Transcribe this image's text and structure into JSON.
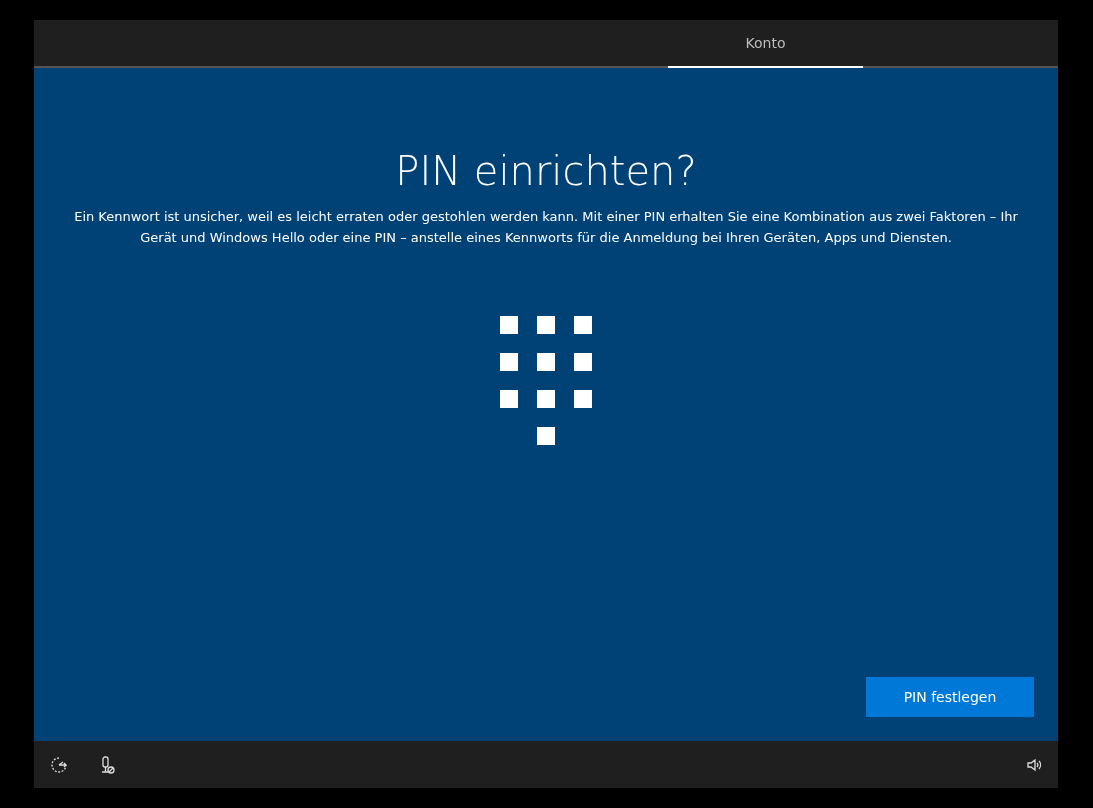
{
  "tabs": [
    {
      "label": "Konto",
      "selected": true
    }
  ],
  "title": "PIN einrichten?",
  "description": "Ein Kennwort ist unsicher, weil es leicht erraten oder gestohlen werden kann. Mit einer PIN erhalten Sie eine Kombination aus zwei Faktoren – Ihr Gerät und Windows Hello oder eine PIN – anstelle eines Kennworts für die Anmeldung bei Ihren Geräten, Apps und Diensten.",
  "primary_button": "PIN festlegen"
}
